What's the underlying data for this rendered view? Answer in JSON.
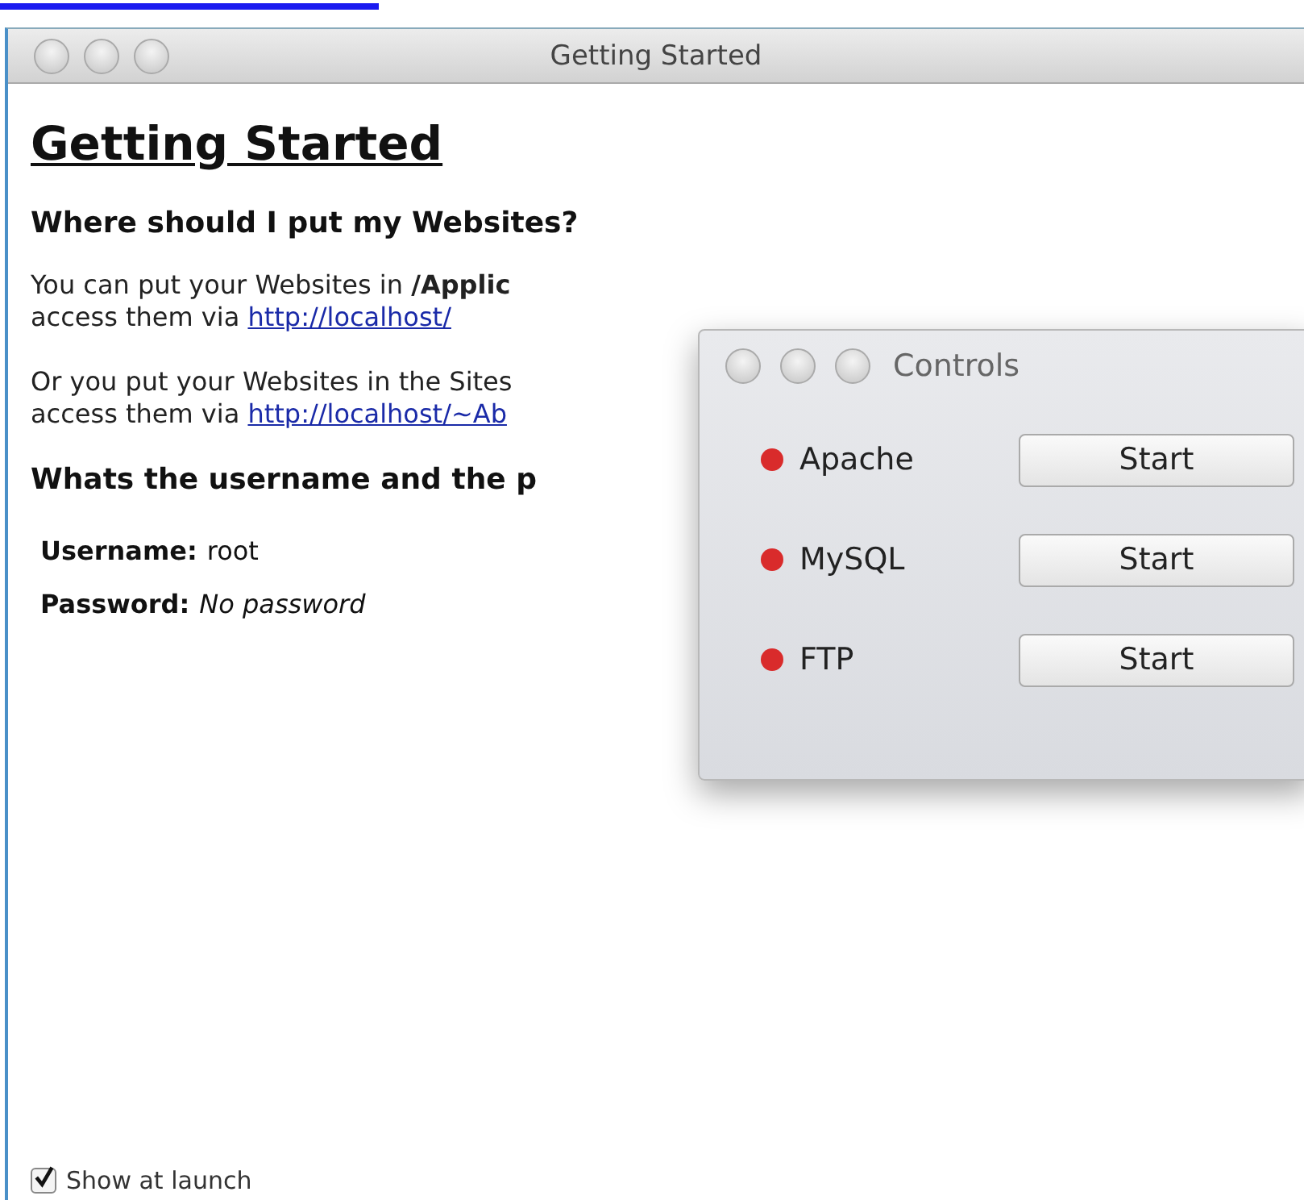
{
  "window": {
    "title": "Getting Started"
  },
  "heading": "Getting Started",
  "sections": [
    {
      "title": "Where should I put my Websites?",
      "paragraphs": [
        {
          "line1": "You can put your Websites in **/Applic**",
          "line2": "access them via",
          "link": "http://localhost/"
        },
        {
          "line1": "Or you put your Websites in the Sites",
          "line2": "access them via",
          "link": "http://localhost/~Ab"
        }
      ]
    },
    {
      "title": "Whats the username and the p",
      "fields": [
        {
          "label": "Username:",
          "value": "root",
          "italic": false
        },
        {
          "label": "Password:",
          "value": "No password",
          "italic": true
        }
      ]
    }
  ],
  "show_at_launch": {
    "label": "Show at launch",
    "checked": true
  },
  "controls": {
    "title": "Controls",
    "services": [
      {
        "name": "Apache",
        "color": "#d92b2b",
        "button": "Start"
      },
      {
        "name": "MySQL",
        "color": "#d92b2b",
        "button": "Start"
      },
      {
        "name": "FTP",
        "color": "#d92b2b",
        "button": "Start"
      }
    ]
  }
}
